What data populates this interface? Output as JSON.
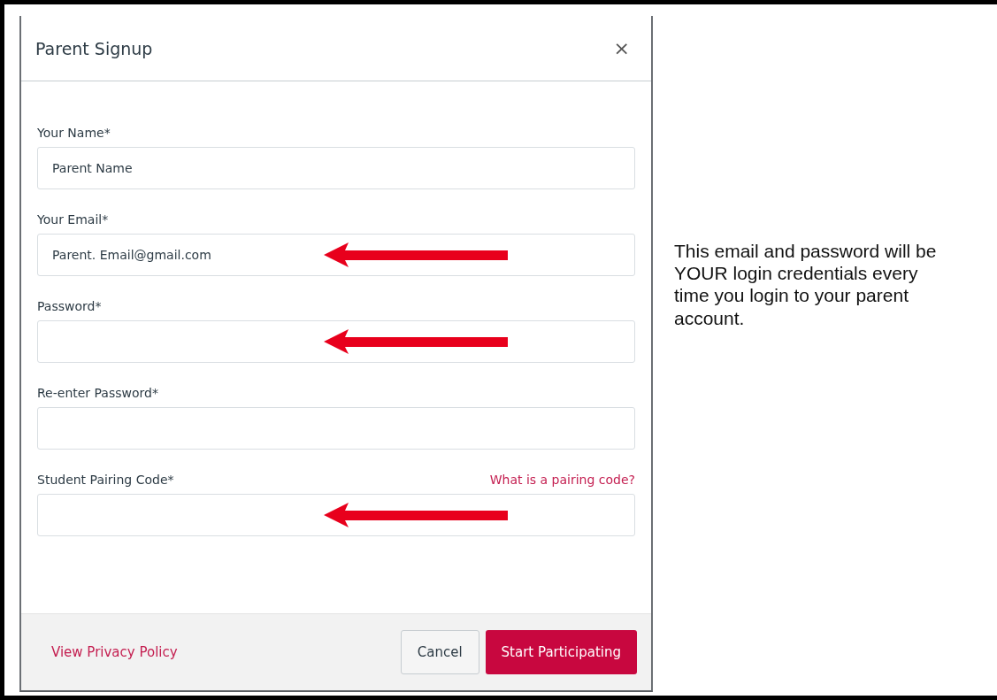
{
  "dialog": {
    "title": "Parent Signup",
    "close": "×",
    "fields": [
      {
        "label": "Your Name*",
        "value": "Parent Name",
        "arrow": false
      },
      {
        "label": "Your Email*",
        "value": "Parent. Email@gmail.com",
        "arrow": true
      },
      {
        "label": "Password*",
        "arrow": true
      },
      {
        "label": "Re-enter Password*",
        "arrow": false
      },
      {
        "label": "Student Pairing Code*",
        "help_link": "What is a pairing code?",
        "arrow": true
      }
    ],
    "footer": {
      "privacy_link": "View Privacy Policy",
      "cancel": "Cancel",
      "submit": "Start Participating"
    }
  },
  "note": "This email and password will be YOUR login credentials every time you login to your parent account."
}
